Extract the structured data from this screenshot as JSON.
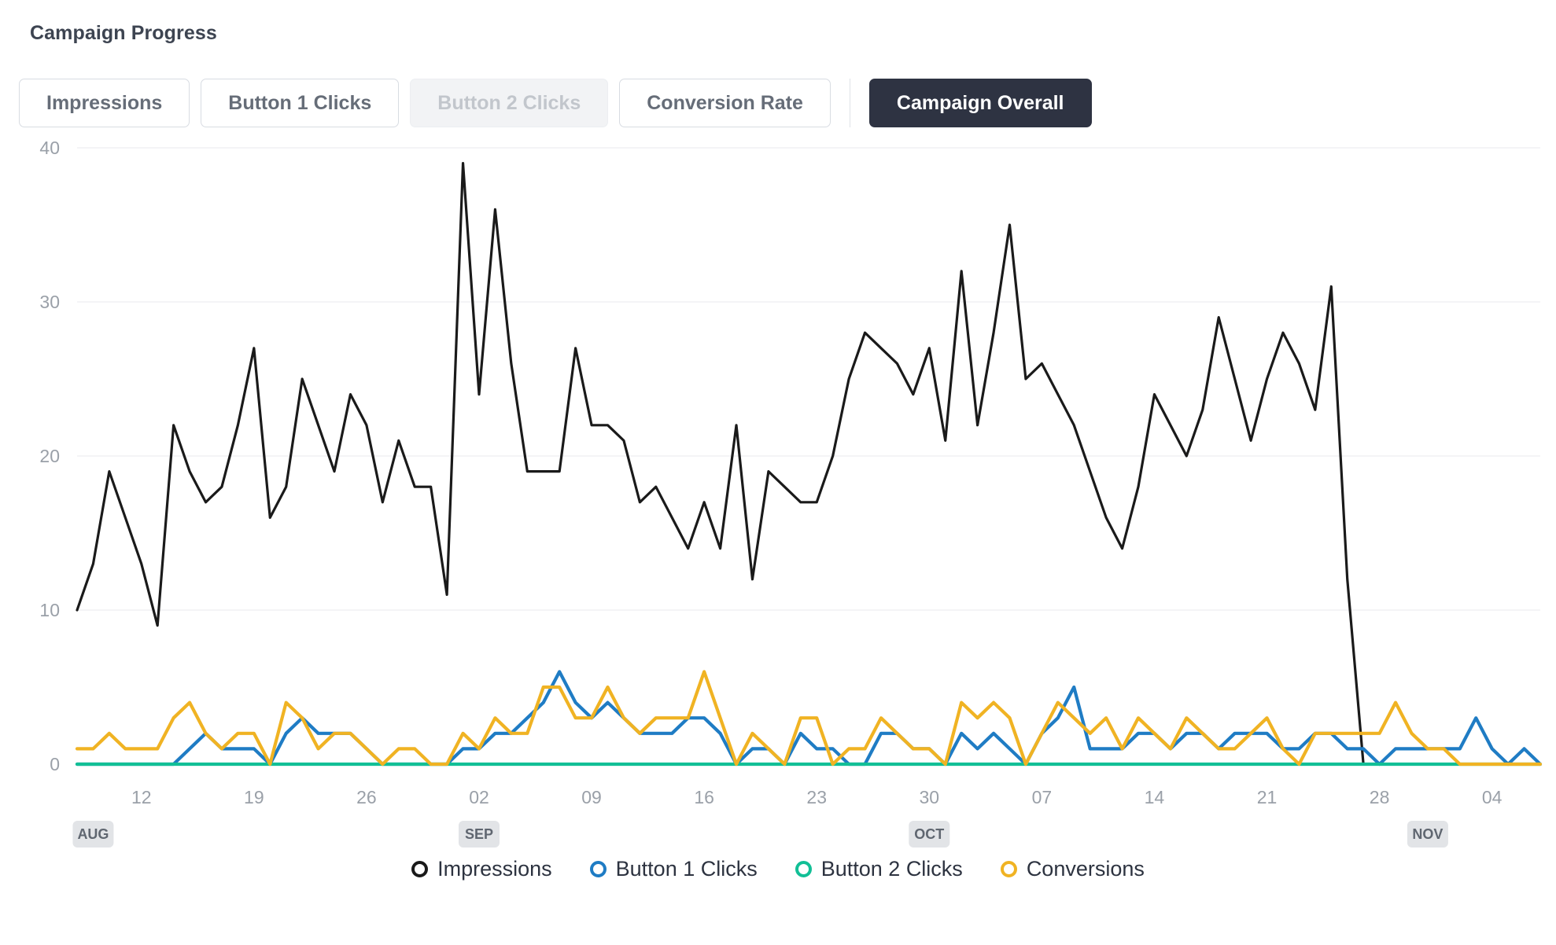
{
  "header": {
    "title": "Campaign Progress"
  },
  "tabs": [
    {
      "label": "Impressions",
      "state": "normal"
    },
    {
      "label": "Button 1 Clicks",
      "state": "normal"
    },
    {
      "label": "Button 2 Clicks",
      "state": "disabled"
    },
    {
      "label": "Conversion Rate",
      "state": "normal"
    },
    {
      "label": "Campaign Overall",
      "state": "active"
    }
  ],
  "colors": {
    "impressions": "#1a1a1a",
    "button1": "#1f7cc4",
    "button2": "#12bf96",
    "conversions": "#f0b323",
    "active_tab_bg": "#2e3342",
    "grid": "#f0f1f3",
    "axis_text": "#9aa0a8"
  },
  "legend": [
    {
      "label": "Impressions",
      "color": "#1a1a1a",
      "marker": "circle-outline-icon"
    },
    {
      "label": "Button 1 Clicks",
      "color": "#1f7cc4",
      "marker": "circle-outline-icon"
    },
    {
      "label": "Button 2 Clicks",
      "color": "#12bf96",
      "marker": "circle-outline-icon"
    },
    {
      "label": "Conversions",
      "color": "#f0b323",
      "marker": "circle-outline-icon"
    }
  ],
  "chart_data": {
    "type": "line",
    "title": "Campaign Progress",
    "xlabel": "",
    "ylabel": "",
    "ylim": [
      0,
      40
    ],
    "yticks": [
      0,
      10,
      20,
      30,
      40
    ],
    "grid": true,
    "legend_position": "bottom",
    "x_tick_labels": [
      "12",
      "19",
      "26",
      "02",
      "09",
      "16",
      "23",
      "30",
      "07",
      "14",
      "21",
      "28",
      "04"
    ],
    "x_tick_indices": [
      4,
      11,
      18,
      25,
      32,
      39,
      46,
      53,
      60,
      67,
      74,
      81,
      88
    ],
    "month_markers": [
      {
        "label": "AUG",
        "index": 1
      },
      {
        "label": "SEP",
        "index": 25
      },
      {
        "label": "OCT",
        "index": 53
      },
      {
        "label": "NOV",
        "index": 84
      }
    ],
    "n_points": 92,
    "series": [
      {
        "name": "Impressions",
        "color": "#1a1a1a",
        "values": [
          10,
          13,
          19,
          16,
          13,
          9,
          22,
          19,
          17,
          18,
          22,
          27,
          16,
          18,
          25,
          22,
          19,
          24,
          22,
          17,
          21,
          18,
          18,
          11,
          39,
          24,
          36,
          26,
          19,
          19,
          19,
          27,
          22,
          22,
          21,
          17,
          18,
          16,
          14,
          17,
          14,
          22,
          12,
          19,
          18,
          17,
          17,
          20,
          25,
          28,
          27,
          26,
          24,
          27,
          21,
          32,
          22,
          28,
          35,
          25,
          26,
          24,
          22,
          19,
          16,
          14,
          18,
          24,
          22,
          20,
          23,
          29,
          25,
          21,
          25,
          28,
          26,
          23,
          31,
          12,
          0,
          0,
          0,
          0,
          0,
          0,
          0,
          0,
          0,
          0,
          0,
          0
        ]
      },
      {
        "name": "Button 1 Clicks",
        "color": "#1f7cc4",
        "values": [
          0,
          0,
          0,
          0,
          0,
          0,
          0,
          1,
          2,
          1,
          1,
          1,
          0,
          2,
          3,
          2,
          2,
          2,
          1,
          0,
          0,
          0,
          0,
          0,
          1,
          1,
          2,
          2,
          3,
          4,
          6,
          4,
          3,
          4,
          3,
          2,
          2,
          2,
          3,
          3,
          2,
          0,
          1,
          1,
          0,
          2,
          1,
          1,
          0,
          0,
          2,
          2,
          1,
          1,
          0,
          2,
          1,
          2,
          1,
          0,
          2,
          3,
          5,
          1,
          1,
          1,
          2,
          2,
          1,
          2,
          2,
          1,
          2,
          2,
          2,
          1,
          1,
          2,
          2,
          1,
          1,
          0,
          1,
          1,
          1,
          1,
          1,
          3,
          1,
          0,
          1,
          0
        ]
      },
      {
        "name": "Button 2 Clicks",
        "color": "#12bf96",
        "values": [
          0,
          0,
          0,
          0,
          0,
          0,
          0,
          0,
          0,
          0,
          0,
          0,
          0,
          0,
          0,
          0,
          0,
          0,
          0,
          0,
          0,
          0,
          0,
          0,
          0,
          0,
          0,
          0,
          0,
          0,
          0,
          0,
          0,
          0,
          0,
          0,
          0,
          0,
          0,
          0,
          0,
          0,
          0,
          0,
          0,
          0,
          0,
          0,
          0,
          0,
          0,
          0,
          0,
          0,
          0,
          0,
          0,
          0,
          0,
          0,
          0,
          0,
          0,
          0,
          0,
          0,
          0,
          0,
          0,
          0,
          0,
          0,
          0,
          0,
          0,
          0,
          0,
          0,
          0,
          0,
          0,
          0,
          0,
          0,
          0,
          0,
          0,
          0,
          0,
          0,
          0,
          0
        ]
      },
      {
        "name": "Conversions",
        "color": "#f0b323",
        "values": [
          1,
          1,
          2,
          1,
          1,
          1,
          3,
          4,
          2,
          1,
          2,
          2,
          0,
          4,
          3,
          1,
          2,
          2,
          1,
          0,
          1,
          1,
          0,
          0,
          2,
          1,
          3,
          2,
          2,
          5,
          5,
          3,
          3,
          5,
          3,
          2,
          3,
          3,
          3,
          6,
          3,
          0,
          2,
          1,
          0,
          3,
          3,
          0,
          1,
          1,
          3,
          2,
          1,
          1,
          0,
          4,
          3,
          4,
          3,
          0,
          2,
          4,
          3,
          2,
          3,
          1,
          3,
          2,
          1,
          3,
          2,
          1,
          1,
          2,
          3,
          1,
          0,
          2,
          2,
          2,
          2,
          2,
          4,
          2,
          1,
          1,
          0,
          0,
          0,
          0,
          0,
          0
        ]
      }
    ]
  }
}
